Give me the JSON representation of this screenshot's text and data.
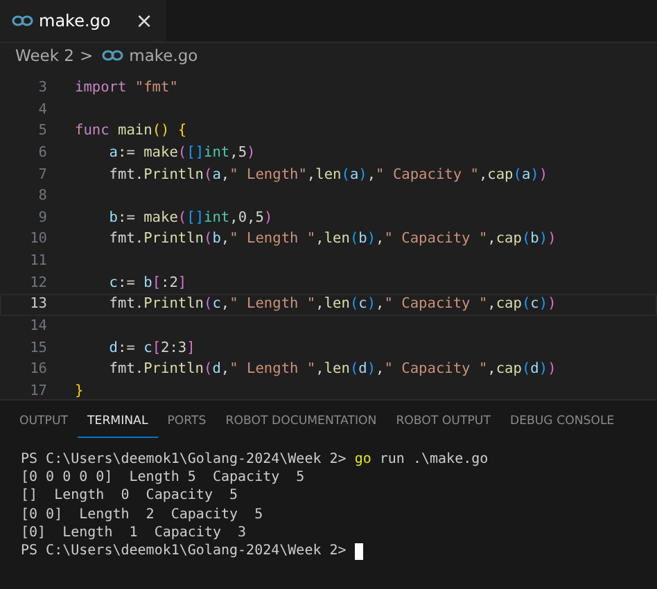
{
  "tabs": [
    {
      "label": "make.go",
      "selected": true,
      "close": "×"
    }
  ],
  "breadcrumb": {
    "folder": "Week 2",
    "separator": ">",
    "file": "make.go"
  },
  "code": [
    {
      "number": "3",
      "current": false,
      "tokens": [
        {
          "text": "import ",
          "kind": "kw"
        },
        {
          "text": "\"fmt\"",
          "kind": "str"
        }
      ]
    },
    {
      "number": "4",
      "current": false
    },
    {
      "number": "5",
      "current": false,
      "tokens": [
        {
          "text": "func ",
          "kind": "kw"
        },
        {
          "text": "main",
          "kind": "fn"
        },
        {
          "text": "() ",
          "kind": "b1"
        },
        {
          "text": "{",
          "kind": "b1"
        }
      ],
      "children": [
        {
          "number": "6",
          "current": false,
          "tokens": [
            {
              "text": "a",
              "kind": "var"
            },
            {
              "text": ":= ",
              "kind": "plain"
            },
            {
              "text": "make",
              "kind": "fn"
            },
            {
              "text": "(",
              "kind": "b2"
            },
            {
              "text": "[]",
              "kind": "b3"
            },
            {
              "text": "int",
              "kind": "type"
            },
            {
              "text": ",5",
              "kind": "plain"
            },
            {
              "text": ")",
              "kind": "b2"
            }
          ]
        },
        {
          "number": "7",
          "current": false,
          "tokens": [
            {
              "text": "fmt.",
              "kind": "plain"
            },
            {
              "text": "Println",
              "kind": "fn"
            },
            {
              "text": "(",
              "kind": "b2"
            },
            {
              "text": "a",
              "kind": "var"
            },
            {
              "text": ",",
              "kind": "plain"
            },
            {
              "text": "\" Length\"",
              "kind": "str"
            },
            {
              "text": ",",
              "kind": "plain"
            },
            {
              "text": "len",
              "kind": "fn"
            },
            {
              "text": "(",
              "kind": "b3"
            },
            {
              "text": "a",
              "kind": "var"
            },
            {
              "text": ")",
              "kind": "b3"
            },
            {
              "text": ",",
              "kind": "plain"
            },
            {
              "text": "\" Capacity \"",
              "kind": "str"
            },
            {
              "text": ",",
              "kind": "plain"
            },
            {
              "text": "cap",
              "kind": "fn"
            },
            {
              "text": "(",
              "kind": "b3"
            },
            {
              "text": "a",
              "kind": "var"
            },
            {
              "text": ")",
              "kind": "b3"
            },
            {
              "text": ")",
              "kind": "b2"
            }
          ]
        },
        {
          "number": "8",
          "current": false
        },
        {
          "number": "9",
          "current": false,
          "tokens": [
            {
              "text": "b",
              "kind": "var"
            },
            {
              "text": ":= ",
              "kind": "plain"
            },
            {
              "text": "make",
              "kind": "fn"
            },
            {
              "text": "(",
              "kind": "b2"
            },
            {
              "text": "[]",
              "kind": "b3"
            },
            {
              "text": "int",
              "kind": "type"
            },
            {
              "text": ",0,5",
              "kind": "plain"
            },
            {
              "text": ")",
              "kind": "b2"
            }
          ]
        },
        {
          "number": "10",
          "current": false,
          "tokens": [
            {
              "text": "fmt.",
              "kind": "plain"
            },
            {
              "text": "Println",
              "kind": "fn"
            },
            {
              "text": "(",
              "kind": "b2"
            },
            {
              "text": "b",
              "kind": "var"
            },
            {
              "text": ",",
              "kind": "plain"
            },
            {
              "text": "\" Length \"",
              "kind": "str"
            },
            {
              "text": ",",
              "kind": "plain"
            },
            {
              "text": "len",
              "kind": "fn"
            },
            {
              "text": "(",
              "kind": "b3"
            },
            {
              "text": "b",
              "kind": "var"
            },
            {
              "text": ")",
              "kind": "b3"
            },
            {
              "text": ",",
              "kind": "plain"
            },
            {
              "text": "\" Capacity \"",
              "kind": "str"
            },
            {
              "text": ",",
              "kind": "plain"
            },
            {
              "text": "cap",
              "kind": "fn"
            },
            {
              "text": "(",
              "kind": "b3"
            },
            {
              "text": "b",
              "kind": "var"
            },
            {
              "text": ")",
              "kind": "b3"
            },
            {
              "text": ")",
              "kind": "b2"
            }
          ]
        },
        {
          "number": "11",
          "current": false
        },
        {
          "number": "12",
          "current": false,
          "tokens": [
            {
              "text": "c",
              "kind": "var"
            },
            {
              "text": ":= ",
              "kind": "plain"
            },
            {
              "text": "b",
              "kind": "var"
            },
            {
              "text": "[",
              "kind": "b2"
            },
            {
              "text": ":2",
              "kind": "plain"
            },
            {
              "text": "]",
              "kind": "b2"
            }
          ]
        },
        {
          "number": "13",
          "current": true,
          "tokens": [
            {
              "text": "fmt.",
              "kind": "plain"
            },
            {
              "text": "Println",
              "kind": "fn"
            },
            {
              "text": "(",
              "kind": "b2"
            },
            {
              "text": "c",
              "kind": "var"
            },
            {
              "text": ",",
              "kind": "plain"
            },
            {
              "text": "\" Length \"",
              "kind": "str"
            },
            {
              "text": ",",
              "kind": "plain"
            },
            {
              "text": "len",
              "kind": "fn"
            },
            {
              "text": "(",
              "kind": "b3"
            },
            {
              "text": "c",
              "kind": "var"
            },
            {
              "text": ")",
              "kind": "b3"
            },
            {
              "text": ",",
              "kind": "plain"
            },
            {
              "text": "\" Capacity \"",
              "kind": "str"
            },
            {
              "text": ",",
              "kind": "plain"
            },
            {
              "text": "cap",
              "kind": "fn"
            },
            {
              "text": "(",
              "kind": "b3"
            },
            {
              "text": "c",
              "kind": "var"
            },
            {
              "text": ")",
              "kind": "b3"
            },
            {
              "text": ")",
              "kind": "b2"
            }
          ]
        },
        {
          "number": "14",
          "current": false
        },
        {
          "number": "15",
          "current": false,
          "tokens": [
            {
              "text": "d",
              "kind": "var"
            },
            {
              "text": ":= ",
              "kind": "plain"
            },
            {
              "text": "c",
              "kind": "var"
            },
            {
              "text": "[",
              "kind": "b2"
            },
            {
              "text": "2:3",
              "kind": "plain"
            },
            {
              "text": "]",
              "kind": "b2"
            }
          ]
        },
        {
          "number": "16",
          "current": false,
          "tokens": [
            {
              "text": "fmt.",
              "kind": "plain"
            },
            {
              "text": "Println",
              "kind": "fn"
            },
            {
              "text": "(",
              "kind": "b2"
            },
            {
              "text": "d",
              "kind": "var"
            },
            {
              "text": ",",
              "kind": "plain"
            },
            {
              "text": "\" Length \"",
              "kind": "str"
            },
            {
              "text": ",",
              "kind": "plain"
            },
            {
              "text": "len",
              "kind": "fn"
            },
            {
              "text": "(",
              "kind": "b3"
            },
            {
              "text": "d",
              "kind": "var"
            },
            {
              "text": ")",
              "kind": "b3"
            },
            {
              "text": ",",
              "kind": "plain"
            },
            {
              "text": "\" Capacity \"",
              "kind": "str"
            },
            {
              "text": ",",
              "kind": "plain"
            },
            {
              "text": "cap",
              "kind": "fn"
            },
            {
              "text": "(",
              "kind": "b3"
            },
            {
              "text": "d",
              "kind": "var"
            },
            {
              "text": ")",
              "kind": "b3"
            },
            {
              "text": ")",
              "kind": "b2"
            }
          ]
        }
      ]
    },
    {
      "number": "17",
      "current": false,
      "tokens": [
        {
          "text": "}",
          "kind": "b1"
        }
      ]
    }
  ],
  "panel_tabs": [
    {
      "label": "OUTPUT",
      "selected": false
    },
    {
      "label": "TERMINAL",
      "selected": true
    },
    {
      "label": "PORTS",
      "selected": false
    },
    {
      "label": "ROBOT DOCUMENTATION",
      "selected": false
    },
    {
      "label": "ROBOT OUTPUT",
      "selected": false
    },
    {
      "label": "DEBUG CONSOLE",
      "selected": false
    }
  ],
  "terminal": [
    {
      "kind": "command",
      "prompt": "PS C:\\Users\\deemok1\\Golang-2024\\Week 2>",
      "command": "go",
      "args": "run .\\make.go"
    },
    {
      "kind": "output",
      "text": "[0 0 0 0 0]  Length 5  Capacity  5"
    },
    {
      "kind": "output",
      "text": "[]  Length  0  Capacity  5"
    },
    {
      "kind": "output",
      "text": "[0 0]  Length  2  Capacity  5"
    },
    {
      "kind": "output",
      "text": "[0]  Length  1  Capacity  3"
    },
    {
      "kind": "cursor",
      "prompt": "PS C:\\Users\\deemok1\\Golang-2024\\Week 2>"
    }
  ]
}
